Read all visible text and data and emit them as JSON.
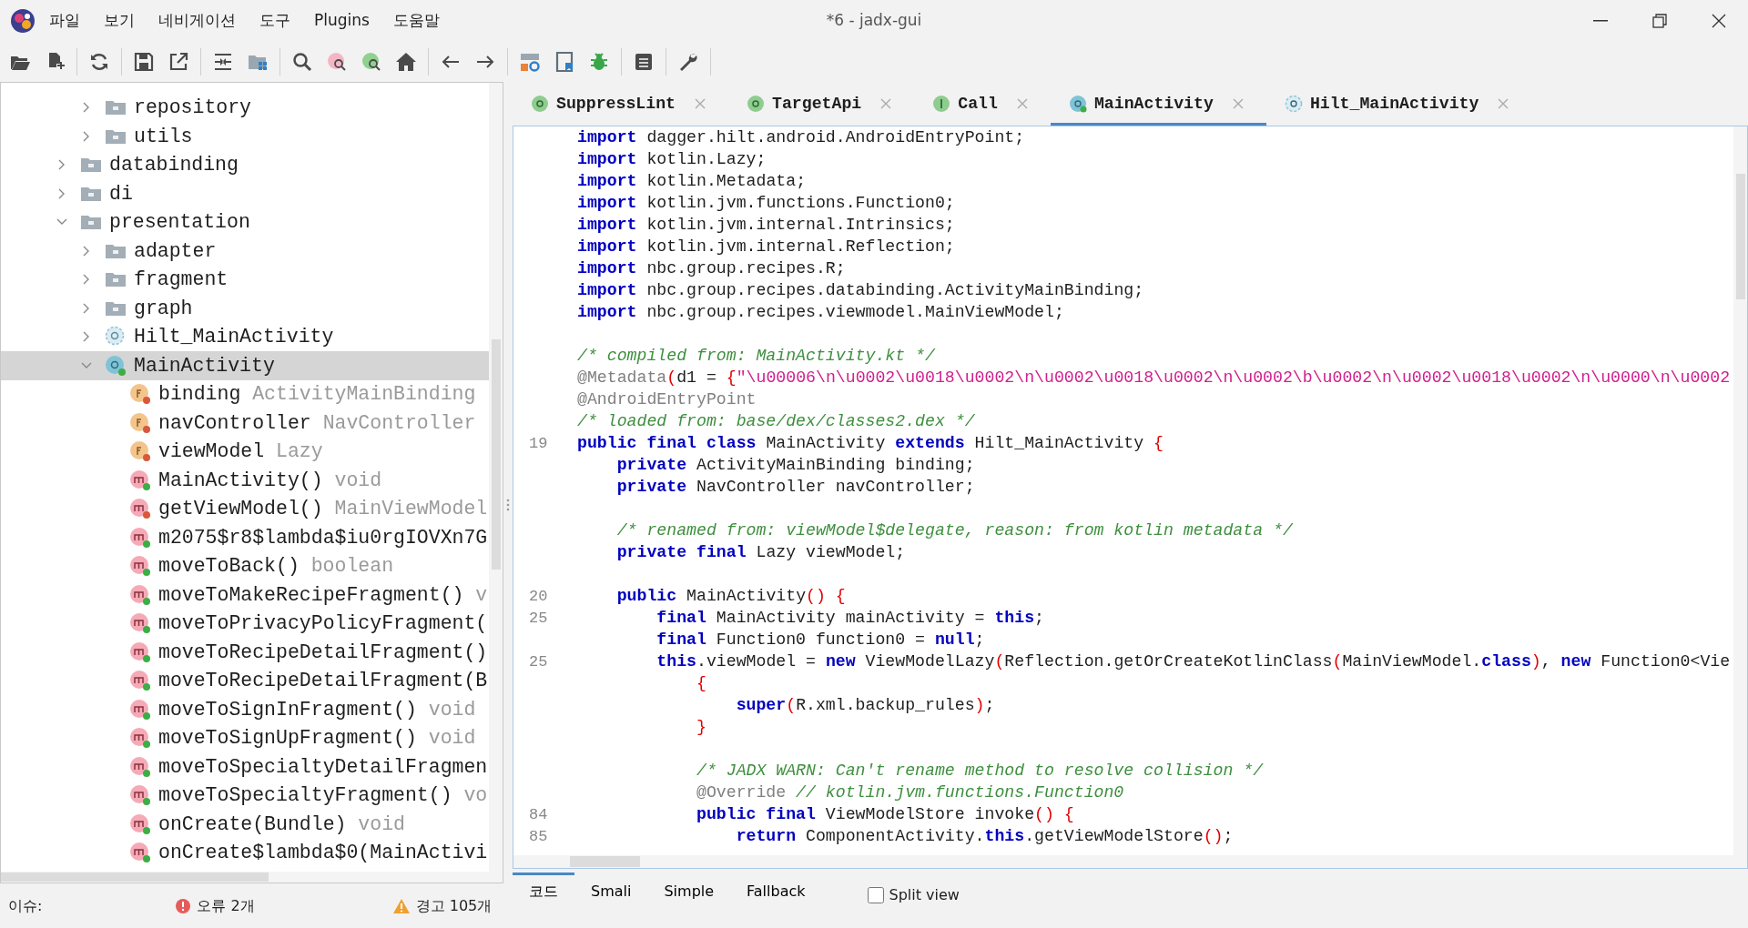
{
  "window": {
    "title": "*6 - jadx-gui"
  },
  "menu": [
    "파일",
    "보기",
    "네비게이션",
    "도구",
    "Plugins",
    "도움말"
  ],
  "tree": {
    "parent_offscreen_children": [
      {
        "label": "repository",
        "kind": "folder",
        "expanded": false,
        "selected": false
      },
      {
        "label": "utils",
        "kind": "folder",
        "expanded": false,
        "selected": false
      }
    ],
    "items": [
      {
        "label": "databinding",
        "kind": "folder",
        "expanded": false,
        "selected": false
      },
      {
        "label": "di",
        "kind": "folder",
        "expanded": false,
        "selected": false
      },
      {
        "label": "presentation",
        "kind": "folder",
        "expanded": true,
        "selected": false,
        "children": [
          {
            "label": "adapter",
            "kind": "folder",
            "expanded": false,
            "selected": false
          },
          {
            "label": "fragment",
            "kind": "folder",
            "expanded": false,
            "selected": false
          },
          {
            "label": "graph",
            "kind": "folder",
            "expanded": false,
            "selected": false
          },
          {
            "label": "Hilt_MainActivity",
            "kind": "class",
            "abstract": true,
            "expanded": false,
            "selected": false
          },
          {
            "label": "MainActivity",
            "kind": "class",
            "abstract": false,
            "color": "#3cae45",
            "expanded": true,
            "selected": true,
            "children": [
              {
                "label": "binding",
                "type": "ActivityMainBinding",
                "kind": "field",
                "color": "#d9583b",
                "selected": false
              },
              {
                "label": "navController",
                "type": "NavController",
                "kind": "field",
                "color": "#d9583b",
                "selected": false
              },
              {
                "label": "viewModel",
                "type": "Lazy",
                "kind": "field",
                "color": "#d9583b",
                "selected": false
              },
              {
                "label": "MainActivity()",
                "type": "void",
                "kind": "method",
                "color": "#3cae45",
                "selected": false
              },
              {
                "label": "getViewModel()",
                "type": "MainViewModel",
                "kind": "method",
                "color": "#d9583b",
                "selected": false
              },
              {
                "label": "m2075$r8$lambda$iu0rgIOVXn7G",
                "kind": "method",
                "color": "#3cae45",
                "selected": false
              },
              {
                "label": "moveToBack()",
                "type": "boolean",
                "kind": "method",
                "color": "#3cae45",
                "selected": false
              },
              {
                "label": "moveToMakeRecipeFragment()",
                "type": "v",
                "kind": "method",
                "color": "#3cae45",
                "selected": false
              },
              {
                "label": "moveToPrivacyPolicyFragment(",
                "kind": "method",
                "color": "#3cae45",
                "selected": false
              },
              {
                "label": "moveToRecipeDetailFragment()",
                "kind": "method",
                "color": "#3cae45",
                "selected": false
              },
              {
                "label": "moveToRecipeDetailFragment(B",
                "kind": "method",
                "color": "#3cae45",
                "selected": false
              },
              {
                "label": "moveToSignInFragment()",
                "type": "void",
                "kind": "method",
                "color": "#3cae45",
                "selected": false
              },
              {
                "label": "moveToSignUpFragment()",
                "type": "void",
                "kind": "method",
                "color": "#3cae45",
                "selected": false
              },
              {
                "label": "moveToSpecialtyDetailFragmen",
                "kind": "method",
                "color": "#3cae45",
                "selected": false
              },
              {
                "label": "moveToSpecialtyFragment()",
                "type": "vo",
                "kind": "method",
                "color": "#3cae45",
                "selected": false
              },
              {
                "label": "onCreate(Bundle)",
                "type": "void",
                "kind": "method",
                "color": "#3cae45",
                "selected": false
              },
              {
                "label": "onCreate$lambda$0(MainActivi",
                "kind": "method",
                "color": "#3cae45",
                "selected": false
              }
            ]
          }
        ]
      }
    ]
  },
  "tabs": [
    {
      "label": "SuppressLint",
      "kind": "annotation",
      "selected": false
    },
    {
      "label": "TargetApi",
      "kind": "annotation",
      "selected": false
    },
    {
      "label": "Call",
      "kind": "interface",
      "selected": false
    },
    {
      "label": "MainActivity",
      "kind": "class",
      "abstract": false,
      "color": "#3cae45",
      "selected": true
    },
    {
      "label": "Hilt_MainActivity",
      "kind": "class",
      "abstract": true,
      "selected": false
    }
  ],
  "code": [
    {
      "kind": "code",
      "tokens": [
        {
          "kind": "keyword",
          "text": "import"
        },
        {
          "kind": "plain",
          "text": " dagger.hilt.android.AndroidEntryPoint;"
        }
      ]
    },
    {
      "kind": "code",
      "tokens": [
        {
          "kind": "keyword",
          "text": "import"
        },
        {
          "kind": "plain",
          "text": " kotlin.Lazy;"
        }
      ]
    },
    {
      "kind": "code",
      "tokens": [
        {
          "kind": "keyword",
          "text": "import"
        },
        {
          "kind": "plain",
          "text": " kotlin.Metadata;"
        }
      ]
    },
    {
      "kind": "code",
      "tokens": [
        {
          "kind": "keyword",
          "text": "import"
        },
        {
          "kind": "plain",
          "text": " kotlin.jvm.functions.Function0;"
        }
      ]
    },
    {
      "kind": "code",
      "tokens": [
        {
          "kind": "keyword",
          "text": "import"
        },
        {
          "kind": "plain",
          "text": " kotlin.jvm.internal.Intrinsics;"
        }
      ]
    },
    {
      "kind": "code",
      "tokens": [
        {
          "kind": "keyword",
          "text": "import"
        },
        {
          "kind": "plain",
          "text": " kotlin.jvm.internal.Reflection;"
        }
      ]
    },
    {
      "kind": "code",
      "tokens": [
        {
          "kind": "keyword",
          "text": "import"
        },
        {
          "kind": "plain",
          "text": " nbc.group.recipes.R;"
        }
      ]
    },
    {
      "kind": "code",
      "tokens": [
        {
          "kind": "keyword",
          "text": "import"
        },
        {
          "kind": "plain",
          "text": " nbc.group.recipes.databinding.ActivityMainBinding;"
        }
      ]
    },
    {
      "kind": "code",
      "tokens": [
        {
          "kind": "keyword",
          "text": "import"
        },
        {
          "kind": "plain",
          "text": " nbc.group.recipes.viewmodel.MainViewModel;"
        }
      ]
    },
    {
      "kind": "blank"
    },
    {
      "kind": "code",
      "tokens": [
        {
          "kind": "comment",
          "text": "/* compiled from: MainActivity.kt */"
        }
      ]
    },
    {
      "kind": "code",
      "tokens": [
        {
          "kind": "annotation",
          "text": "@Metadata"
        },
        {
          "kind": "brace",
          "text": "("
        },
        {
          "kind": "plain",
          "text": "d1 = "
        },
        {
          "kind": "brace",
          "text": "{"
        },
        {
          "kind": "string",
          "text": "\"\\u00006\\n\\u0002\\u0018\\u0002\\n\\u0002\\u0018\\u0002\\n\\u0002\\b\\u0002\\n\\u0002\\u0018\\u0002\\n\\u0000\\n\\u0002"
        }
      ]
    },
    {
      "kind": "code",
      "tokens": [
        {
          "kind": "annotation",
          "text": "@AndroidEntryPoint"
        }
      ]
    },
    {
      "kind": "code",
      "tokens": [
        {
          "kind": "comment",
          "text": "/* loaded from: base/dex/classes2.dex */"
        }
      ]
    },
    {
      "kind": "code",
      "number": "19",
      "tokens": [
        {
          "kind": "keyword",
          "text": "public final class"
        },
        {
          "kind": "plain",
          "text": " MainActivity "
        },
        {
          "kind": "keyword",
          "text": "extends"
        },
        {
          "kind": "plain",
          "text": " Hilt_MainActivity "
        },
        {
          "kind": "brace",
          "text": "{"
        }
      ]
    },
    {
      "kind": "code",
      "tokens": [
        {
          "kind": "keyword",
          "text": "    private"
        },
        {
          "kind": "plain",
          "text": " ActivityMainBinding binding;"
        }
      ]
    },
    {
      "kind": "code",
      "tokens": [
        {
          "kind": "keyword",
          "text": "    private"
        },
        {
          "kind": "plain",
          "text": " NavController navController;"
        }
      ]
    },
    {
      "kind": "blank"
    },
    {
      "kind": "code",
      "tokens": [
        {
          "kind": "comment",
          "text": "    /* renamed from: viewModel$delegate, reason: from kotlin metadata */"
        }
      ]
    },
    {
      "kind": "code",
      "tokens": [
        {
          "kind": "keyword",
          "text": "    private final"
        },
        {
          "kind": "plain",
          "text": " Lazy viewModel;"
        }
      ]
    },
    {
      "kind": "blank"
    },
    {
      "kind": "code",
      "number": "20",
      "tokens": [
        {
          "kind": "keyword",
          "text": "    public"
        },
        {
          "kind": "plain",
          "text": " MainActivity"
        },
        {
          "kind": "brace",
          "text": "() {"
        }
      ]
    },
    {
      "kind": "code",
      "number": "25",
      "tokens": [
        {
          "kind": "keyword",
          "text": "        final"
        },
        {
          "kind": "plain",
          "text": " MainActivity mainActivity = "
        },
        {
          "kind": "keyword",
          "text": "this"
        },
        {
          "kind": "plain",
          "text": ";"
        }
      ]
    },
    {
      "kind": "code",
      "tokens": [
        {
          "kind": "keyword",
          "text": "        final"
        },
        {
          "kind": "plain",
          "text": " Function0 function0 = "
        },
        {
          "kind": "keyword",
          "text": "null"
        },
        {
          "kind": "plain",
          "text": ";"
        }
      ]
    },
    {
      "kind": "code",
      "number": "25",
      "tokens": [
        {
          "kind": "keyword",
          "text": "        this"
        },
        {
          "kind": "plain",
          "text": ".viewModel = "
        },
        {
          "kind": "keyword",
          "text": "new"
        },
        {
          "kind": "plain",
          "text": " ViewModelLazy"
        },
        {
          "kind": "brace",
          "text": "("
        },
        {
          "kind": "plain",
          "text": "Reflection.getOrCreateKotlinClass"
        },
        {
          "kind": "brace",
          "text": "("
        },
        {
          "kind": "plain",
          "text": "MainViewModel."
        },
        {
          "kind": "keyword",
          "text": "class"
        },
        {
          "kind": "brace",
          "text": ")"
        },
        {
          "kind": "plain",
          "text": ", "
        },
        {
          "kind": "keyword",
          "text": "new"
        },
        {
          "kind": "plain",
          "text": " Function0<Vie"
        }
      ]
    },
    {
      "kind": "code",
      "tokens": [
        {
          "kind": "brace",
          "text": "            {"
        }
      ]
    },
    {
      "kind": "code",
      "tokens": [
        {
          "kind": "keyword",
          "text": "                super"
        },
        {
          "kind": "brace",
          "text": "("
        },
        {
          "kind": "plain",
          "text": "R.xml.backup_rules"
        },
        {
          "kind": "brace",
          "text": ")"
        },
        {
          "kind": "plain",
          "text": ";"
        }
      ]
    },
    {
      "kind": "code",
      "tokens": [
        {
          "kind": "brace",
          "text": "            }"
        }
      ]
    },
    {
      "kind": "blank"
    },
    {
      "kind": "code",
      "tokens": [
        {
          "kind": "comment",
          "text": "            /* JADX WARN: Can't rename method to resolve collision */"
        }
      ]
    },
    {
      "kind": "code",
      "tokens": [
        {
          "kind": "annotation",
          "text": "            @Override"
        },
        {
          "kind": "comment",
          "text": " // kotlin.jvm.functions.Function0"
        }
      ]
    },
    {
      "kind": "code",
      "number": "84",
      "tokens": [
        {
          "kind": "keyword",
          "text": "            public final"
        },
        {
          "kind": "plain",
          "text": " ViewModelStore invoke"
        },
        {
          "kind": "brace",
          "text": "() {"
        }
      ]
    },
    {
      "kind": "code",
      "number": "85",
      "tokens": [
        {
          "kind": "keyword",
          "text": "                return"
        },
        {
          "kind": "plain",
          "text": " ComponentActivity."
        },
        {
          "kind": "keyword",
          "text": "this"
        },
        {
          "kind": "plain",
          "text": ".getViewModelStore"
        },
        {
          "kind": "brace",
          "text": "()"
        },
        {
          "kind": "plain",
          "text": ";"
        }
      ]
    }
  ],
  "view_tabs": [
    {
      "label": "코드",
      "selected": true
    },
    {
      "label": "Smali",
      "selected": false
    },
    {
      "label": "Simple",
      "selected": false
    },
    {
      "label": "Fallback",
      "selected": false
    }
  ],
  "split_view": {
    "label": "Split view",
    "checked": false
  },
  "status_bar": {
    "issues_label": "이슈:",
    "errors": "오류 2개",
    "warnings": "경고 105개"
  }
}
